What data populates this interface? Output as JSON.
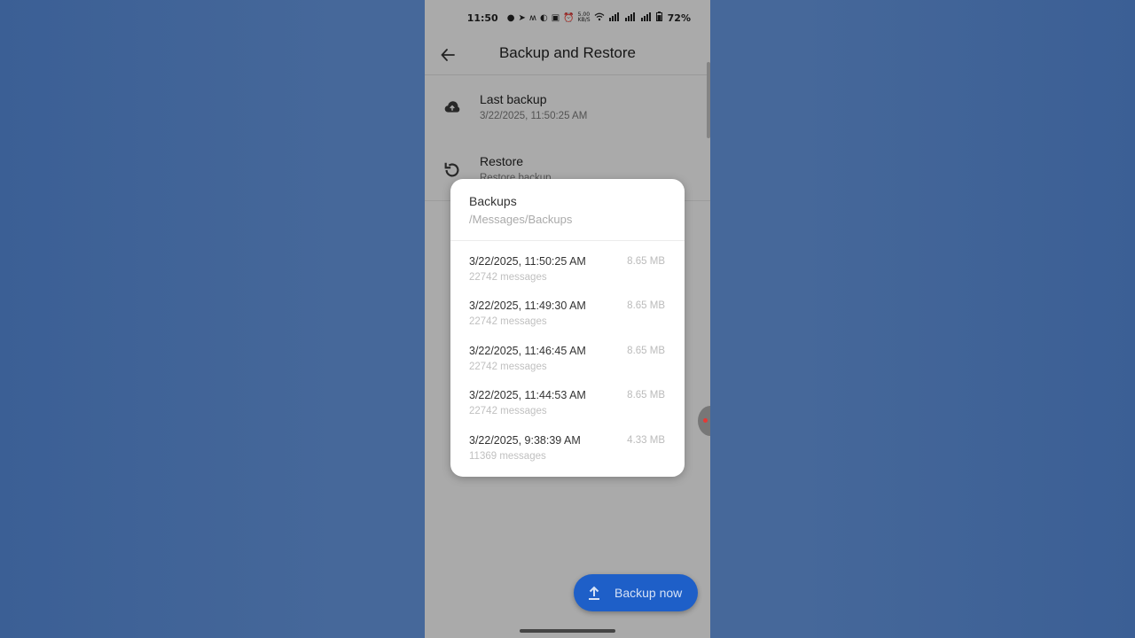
{
  "status_bar": {
    "time": "11:50",
    "net_speed": "5.00 KB/S",
    "battery": "72%"
  },
  "app_bar": {
    "title": "Backup and Restore"
  },
  "settings": {
    "last_backup": {
      "title": "Last backup",
      "subtitle": "3/22/2025, 11:50:25 AM"
    },
    "restore": {
      "title": "Restore",
      "subtitle": "Restore backup"
    }
  },
  "dialog": {
    "title": "Backups",
    "path": "/Messages/Backups",
    "items": [
      {
        "date": "3/22/2025, 11:50:25 AM",
        "size": "8.65 MB",
        "count": "22742 messages"
      },
      {
        "date": "3/22/2025, 11:49:30 AM",
        "size": "8.65 MB",
        "count": "22742 messages"
      },
      {
        "date": "3/22/2025, 11:46:45 AM",
        "size": "8.65 MB",
        "count": "22742 messages"
      },
      {
        "date": "3/22/2025, 11:44:53 AM",
        "size": "8.65 MB",
        "count": "22742 messages"
      },
      {
        "date": "3/22/2025, 9:38:39 AM",
        "size": "4.33 MB",
        "count": "11369 messages"
      }
    ]
  },
  "fab": {
    "label": "Backup now"
  },
  "colors": {
    "fab": "#1e5fc8",
    "background": "#46689a"
  }
}
